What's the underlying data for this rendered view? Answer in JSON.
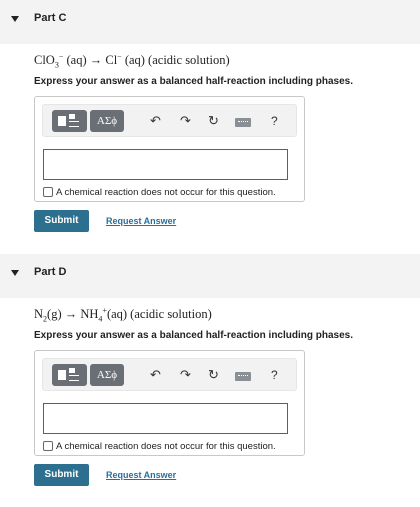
{
  "parts": [
    {
      "title": "Part C",
      "equation": {
        "lhs_main": "ClO",
        "lhs_sub": "3",
        "lhs_sup": "−",
        "lhs_phase": " (aq) → Cl",
        "rhs_sup": "−",
        "rhs_rest": " (aq) (acidic solution)"
      },
      "instruction": "Express your answer as a balanced half-reaction including phases.",
      "toolbar": {
        "greek_label": "ΑΣϕ",
        "help_label": "?"
      },
      "input_value": "",
      "no_reaction_label": "A chemical reaction does not occur for this question.",
      "submit_label": "Submit",
      "request_label": "Request Answer"
    },
    {
      "title": "Part D",
      "equation": {
        "a": "N",
        "a_sub": "2",
        "b": "(g) → NH",
        "b_sub": "4",
        "b_sup": "+",
        "c": "(aq) (acidic solution)"
      },
      "instruction": "Express your answer as a balanced half-reaction including phases.",
      "toolbar": {
        "greek_label": "ΑΣϕ",
        "help_label": "?"
      },
      "input_value": "",
      "no_reaction_label": "A chemical reaction does not occur for this question.",
      "submit_label": "Submit",
      "request_label": "Request Answer"
    }
  ],
  "icons": {
    "collapse": "caret-down-icon",
    "templates": "templates-icon",
    "undo": "undo-icon",
    "redo": "redo-icon",
    "reset": "reset-icon",
    "keyboard": "keyboard-icon",
    "help": "help-icon"
  },
  "colors": {
    "accent": "#2d6f8f",
    "link": "#2a6f9a",
    "header_bg": "#f3f3f3",
    "toolbar_btn": "#6a6f76"
  }
}
